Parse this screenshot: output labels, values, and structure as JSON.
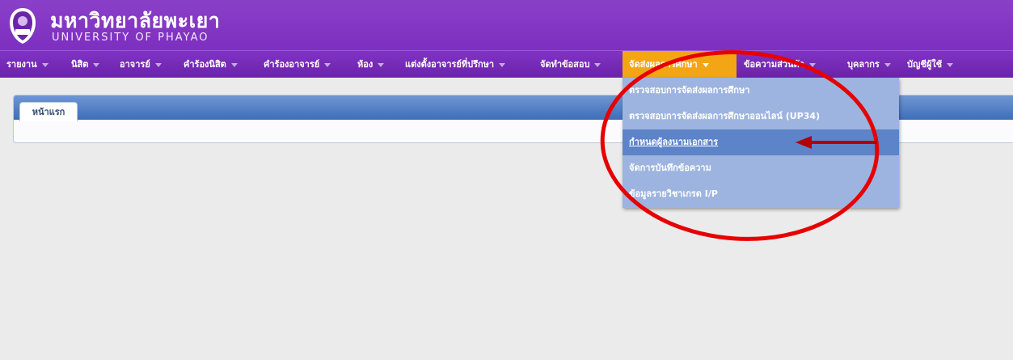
{
  "header": {
    "university_th": "มหาวิทยาลัยพะเยา",
    "university_en": "UNIVERSITY OF PHAYAO",
    "logo_icon": "university-seal-icon",
    "bg_color": "#7d2fbf"
  },
  "menu": {
    "items": [
      {
        "label": "รายงาน"
      },
      {
        "label": "นิสิต"
      },
      {
        "label": "อาจารย์"
      },
      {
        "label": "คำร้องนิสิต"
      },
      {
        "label": "คำร้องอาจารย์"
      },
      {
        "label": "ห้อง"
      },
      {
        "label": "แต่งตั้งอาจารย์ที่ปรึกษา"
      },
      {
        "label": "จัดทำข้อสอบ"
      },
      {
        "label": "จัดส่งผลการศึกษา"
      },
      {
        "label": "ข้อความส่วนตัว"
      },
      {
        "label": "บุคลากร"
      },
      {
        "label": "บัญชีผู้ใช้"
      }
    ],
    "active_index": 8,
    "active_color": "#f4a516"
  },
  "dropdown": {
    "items": [
      {
        "label": "ตรวจสอบการจัดส่งผลการศึกษา"
      },
      {
        "label": "ตรวจสอบการจัดส่งผลการศึกษาออนไลน์ (UP34)"
      },
      {
        "label": "กำหนดผู้ลงนามเอกสาร"
      },
      {
        "label": "จัดการบันทึกข้อความ"
      },
      {
        "label": "ข้อมูลรายวิชาเกรด I/P"
      }
    ],
    "highlighted_index": 2
  },
  "tabs": [
    {
      "label": "หน้าแรก"
    }
  ],
  "annotation": {
    "color": "#e60000"
  }
}
